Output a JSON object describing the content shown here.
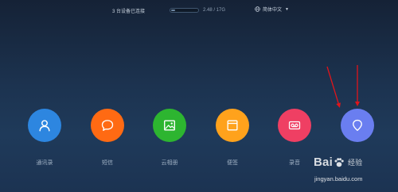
{
  "topbar": {
    "devices_status": "3 台设备已连接",
    "storage": {
      "used_label": "2.48 / 17G",
      "used_fraction": 0.15
    },
    "language": {
      "label": "简体中文",
      "icon": "globe-icon"
    }
  },
  "apps": [
    {
      "label": "通讯录",
      "icon": "person-icon",
      "color": "#2d86e0"
    },
    {
      "label": "短信",
      "icon": "chat-bubble-icon",
      "color": "#ff6a13"
    },
    {
      "label": "云相册",
      "icon": "image-icon",
      "color": "#2db530"
    },
    {
      "label": "便签",
      "icon": "notepad-icon",
      "color": "#ffa21c"
    },
    {
      "label": "录音",
      "icon": "voicemail-icon",
      "color": "#ef3f63"
    },
    {
      "label": "",
      "icon": "location-pin-icon",
      "color": "#6a7ef0"
    }
  ],
  "colors": {
    "background": "#1c3350",
    "annotation_arrows": "#e0151b"
  },
  "watermark": {
    "logo": "Bai",
    "logo_suffix": "经验",
    "url": "jingyan.baidu.com"
  }
}
